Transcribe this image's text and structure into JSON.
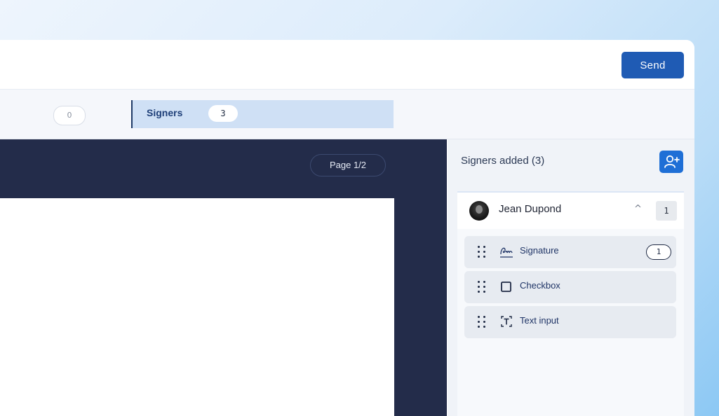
{
  "header": {
    "send_label": "Send"
  },
  "tabs": {
    "left_tab_count": "0",
    "signers": {
      "label": "Signers",
      "count": "3"
    }
  },
  "document": {
    "page_indicator": "Page 1/2"
  },
  "sidebar": {
    "title": "Signers added (3)",
    "add_signer_icon": "user-plus-icon",
    "signer": {
      "name": "Jean Dupond",
      "expanded": true,
      "count": "1",
      "fields": [
        {
          "label": "Signature",
          "icon": "signature-icon",
          "count": "1"
        },
        {
          "label": "Checkbox",
          "icon": "checkbox-icon"
        },
        {
          "label": "Text input",
          "icon": "text-input-icon"
        }
      ]
    }
  },
  "colors": {
    "primary": "#1f5bb4",
    "accent": "#1f6fd6",
    "dark_navy": "#232c4a",
    "tab_active_bg": "#cfe0f5"
  }
}
